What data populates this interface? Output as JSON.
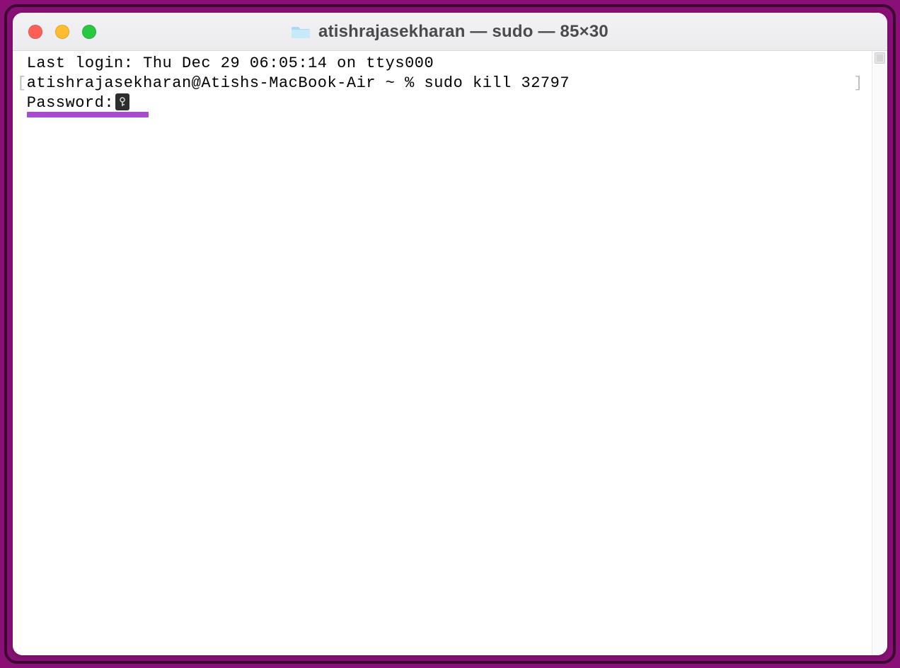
{
  "window": {
    "title": "atishrajasekharan — sudo — 85×30"
  },
  "terminal": {
    "line1": "Last login: Thu Dec 29 06:05:14 on ttys000",
    "prompt_open_bracket": "[",
    "prompt": "atishrajasekharan@Atishs-MacBook-Air ~ % ",
    "command": "sudo kill 32797",
    "prompt_close_bracket": "]",
    "password_label": "Password:"
  },
  "icons": {
    "folder": "folder-icon",
    "key": "key-icon"
  },
  "colors": {
    "accent_purple": "#a84bd1",
    "frame_purple": "#8a1078"
  }
}
